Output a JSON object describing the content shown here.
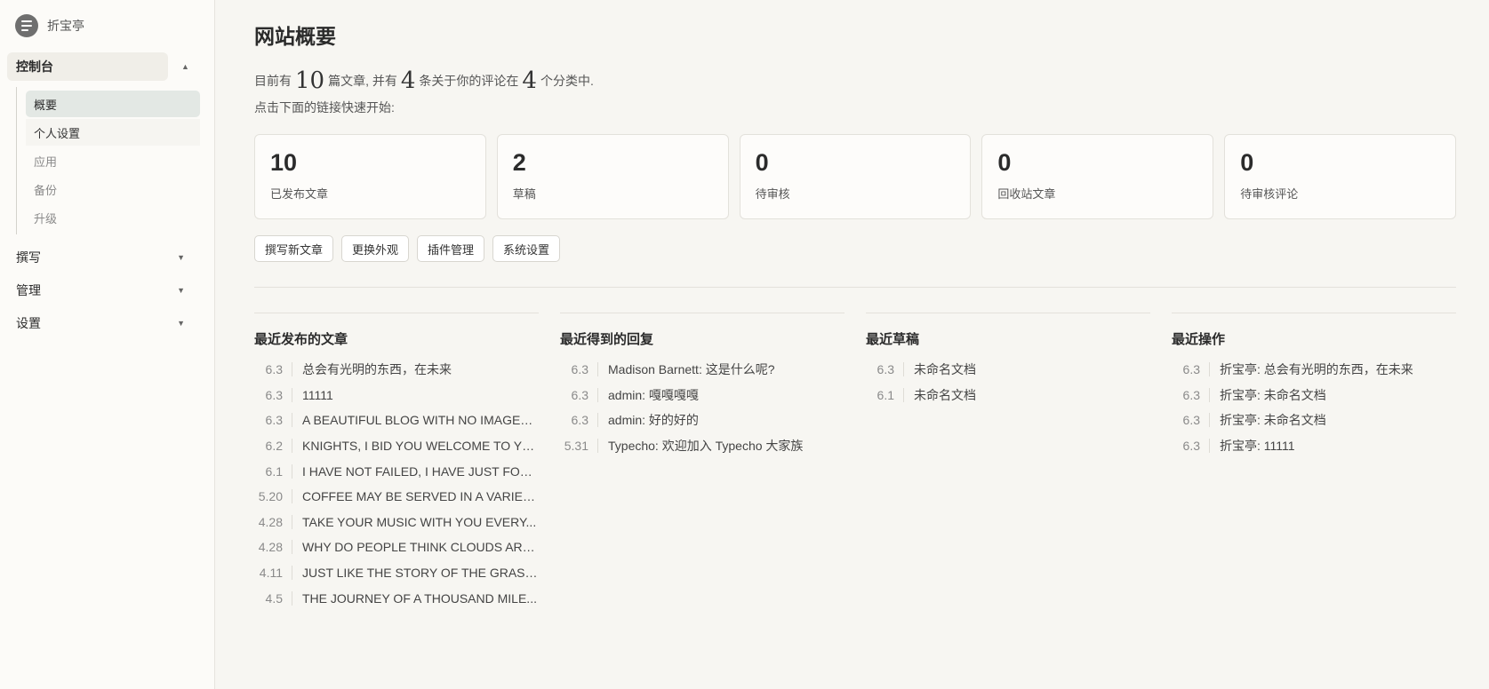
{
  "brand": {
    "name": "折宝亭"
  },
  "sidebar": {
    "groups": [
      {
        "label": "控制台",
        "expanded": true
      },
      {
        "label": "撰写"
      },
      {
        "label": "管理"
      },
      {
        "label": "设置"
      }
    ],
    "console_items": [
      "概要",
      "个人设置",
      "应用",
      "备份",
      "升级"
    ]
  },
  "page": {
    "title": "网站概要",
    "summary": {
      "p1": "目前有",
      "posts": "10",
      "p2": "篇文章, 并有",
      "comments": "4",
      "p3": "条关于你的评论在",
      "categories": "4",
      "p4": "个分类中."
    },
    "quick_hint": "点击下面的链接快速开始:"
  },
  "stats": [
    {
      "value": "10",
      "label": "已发布文章"
    },
    {
      "value": "2",
      "label": "草稿"
    },
    {
      "value": "0",
      "label": "待审核"
    },
    {
      "value": "0",
      "label": "回收站文章"
    },
    {
      "value": "0",
      "label": "待审核评论"
    }
  ],
  "actions": [
    "撰写新文章",
    "更换外观",
    "插件管理",
    "系统设置"
  ],
  "recent_posts": {
    "title": "最近发布的文章",
    "items": [
      {
        "date": "6.3",
        "text": "总会有光明的东西，在未来"
      },
      {
        "date": "6.3",
        "text": "11111"
      },
      {
        "date": "6.3",
        "text": "A BEAUTIFUL BLOG WITH NO IMAGES ..."
      },
      {
        "date": "6.2",
        "text": "KNIGHTS, I BID YOU WELCOME TO YO..."
      },
      {
        "date": "6.1",
        "text": "I HAVE NOT FAILED, I HAVE JUST FOU..."
      },
      {
        "date": "5.20",
        "text": "COFFEE MAY BE SERVED IN A VARIETY..."
      },
      {
        "date": "4.28",
        "text": "TAKE YOUR MUSIC WITH YOU EVERY..."
      },
      {
        "date": "4.28",
        "text": "WHY DO PEOPLE THINK CLOUDS ARE ..."
      },
      {
        "date": "4.11",
        "text": "JUST LIKE THE STORY OF THE GRASS..."
      },
      {
        "date": "4.5",
        "text": "THE JOURNEY OF A THOUSAND MILE..."
      }
    ]
  },
  "recent_replies": {
    "title": "最近得到的回复",
    "items": [
      {
        "date": "6.3",
        "text": "Madison Barnett: 这是什么呢?"
      },
      {
        "date": "6.3",
        "text": "admin: 嘎嘎嘎嘎"
      },
      {
        "date": "6.3",
        "text": "admin: 好的好的"
      },
      {
        "date": "5.31",
        "text": "Typecho: 欢迎加入 Typecho 大家族"
      }
    ]
  },
  "recent_drafts": {
    "title": "最近草稿",
    "items": [
      {
        "date": "6.3",
        "text": "未命名文档"
      },
      {
        "date": "6.1",
        "text": "未命名文档"
      }
    ]
  },
  "recent_actions": {
    "title": "最近操作",
    "items": [
      {
        "date": "6.3",
        "text": "折宝亭: 总会有光明的东西，在未来"
      },
      {
        "date": "6.3",
        "text": "折宝亭: 未命名文档"
      },
      {
        "date": "6.3",
        "text": "折宝亭: 未命名文档"
      },
      {
        "date": "6.3",
        "text": "折宝亭: 11111"
      }
    ]
  }
}
